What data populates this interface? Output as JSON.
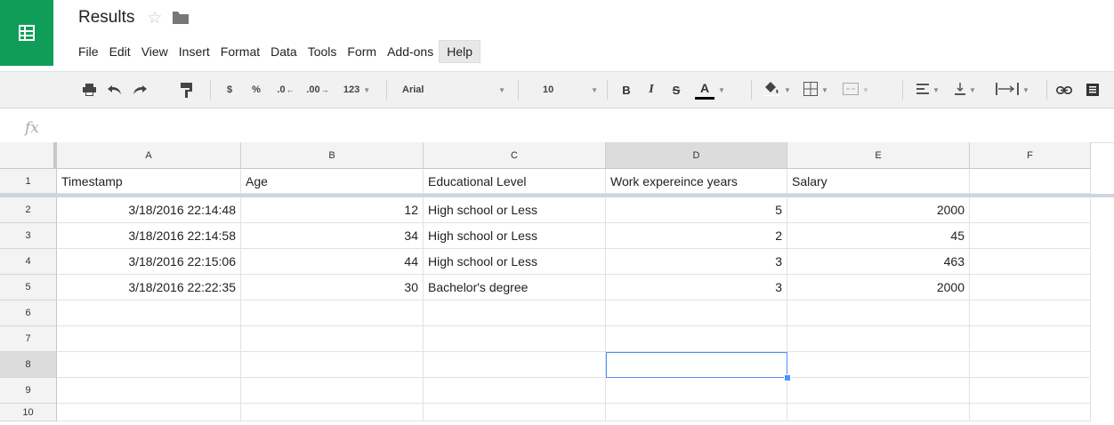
{
  "app": {
    "title": "Results"
  },
  "menu": [
    "File",
    "Edit",
    "View",
    "Insert",
    "Format",
    "Data",
    "Tools",
    "Form",
    "Add-ons",
    "Help"
  ],
  "toolbar": {
    "currency": "$",
    "percent": "%",
    "dec_decrease": ".0",
    "dec_increase": ".00",
    "more_formats": "123",
    "font": "Arial",
    "font_size": "10",
    "bold": "B",
    "italic": "I",
    "strike": "S",
    "text_color": "A"
  },
  "formula_bar": {
    "fx": "fx",
    "value": ""
  },
  "columns": [
    "A",
    "B",
    "C",
    "D",
    "E",
    "F"
  ],
  "rows": [
    {
      "num": "1",
      "cells": [
        "Timestamp",
        "Age",
        "Educational Level",
        "Work expereince years",
        "Salary",
        ""
      ]
    },
    {
      "num": "2",
      "cells": [
        "3/18/2016 22:14:48",
        "12",
        "High school or Less",
        "5",
        "2000",
        ""
      ]
    },
    {
      "num": "3",
      "cells": [
        "3/18/2016 22:14:58",
        "34",
        "High school or Less",
        "2",
        "45",
        ""
      ]
    },
    {
      "num": "4",
      "cells": [
        "3/18/2016 22:15:06",
        "44",
        "High school or Less",
        "3",
        "463",
        ""
      ]
    },
    {
      "num": "5",
      "cells": [
        "3/18/2016 22:22:35",
        "30",
        "Bachelor's degree",
        "3",
        "2000",
        ""
      ]
    },
    {
      "num": "6",
      "cells": [
        "",
        "",
        "",
        "",
        "",
        ""
      ]
    },
    {
      "num": "7",
      "cells": [
        "",
        "",
        "",
        "",
        "",
        ""
      ]
    },
    {
      "num": "8",
      "cells": [
        "",
        "",
        "",
        "",
        "",
        ""
      ]
    },
    {
      "num": "9",
      "cells": [
        "",
        "",
        "",
        "",
        "",
        ""
      ]
    },
    {
      "num": "10",
      "cells": [
        "",
        "",
        "",
        "",
        "",
        ""
      ]
    }
  ],
  "selection": {
    "cell": "D8"
  },
  "colors": {
    "brand": "#0f9d58",
    "selection": "#4d90fe"
  }
}
